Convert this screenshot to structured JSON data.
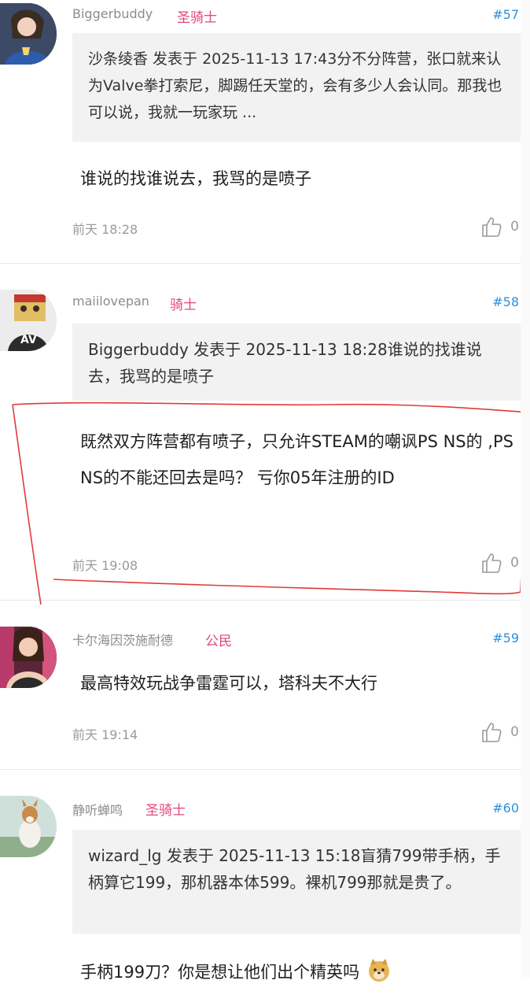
{
  "posts": [
    {
      "username": "Biggerbuddy",
      "badge": "圣骑士",
      "floor": "#57",
      "quote": "沙条绫香 发表于 2025-11-13 17:43分不分阵营，张口就来认为Valve拳打索尼，脚踢任天堂的，会有多少人会认同。那我也可以说，我就一玩家玩 ...",
      "content": "谁说的找谁说去，我骂的是喷子",
      "time": "前天 18:28",
      "likes": "0"
    },
    {
      "username": "maiilovepan",
      "badge": "骑士",
      "floor": "#58",
      "quote": "Biggerbuddy 发表于 2025-11-13 18:28谁说的找谁说去，我骂的是喷子",
      "content": "既然双方阵营都有喷子，只允许STEAM的嘲讽PS NS的 ,PS NS的不能还回去是吗？ 亏你05年注册的ID",
      "time": "前天 19:08",
      "likes": "0"
    },
    {
      "username": "卡尔海因茨施耐德",
      "badge": "公民",
      "floor": "#59",
      "content": "最高特效玩战争雷霆可以，塔科夫不大行",
      "time": "前天 19:14",
      "likes": "0"
    },
    {
      "username": "静听蝉鸣",
      "badge": "圣骑士",
      "floor": "#60",
      "quote": "wizard_lg 发表于 2025-11-13 15:18盲猜799带手柄，手柄算它199，那机器本体599。裸机799那就是贵了。",
      "content": "手柄199刀？你是想让他们出个精英吗"
    }
  ],
  "colors": {
    "badge": "#e0467c",
    "floor": "#2f8fd8",
    "annotation": "#e23a3a"
  }
}
